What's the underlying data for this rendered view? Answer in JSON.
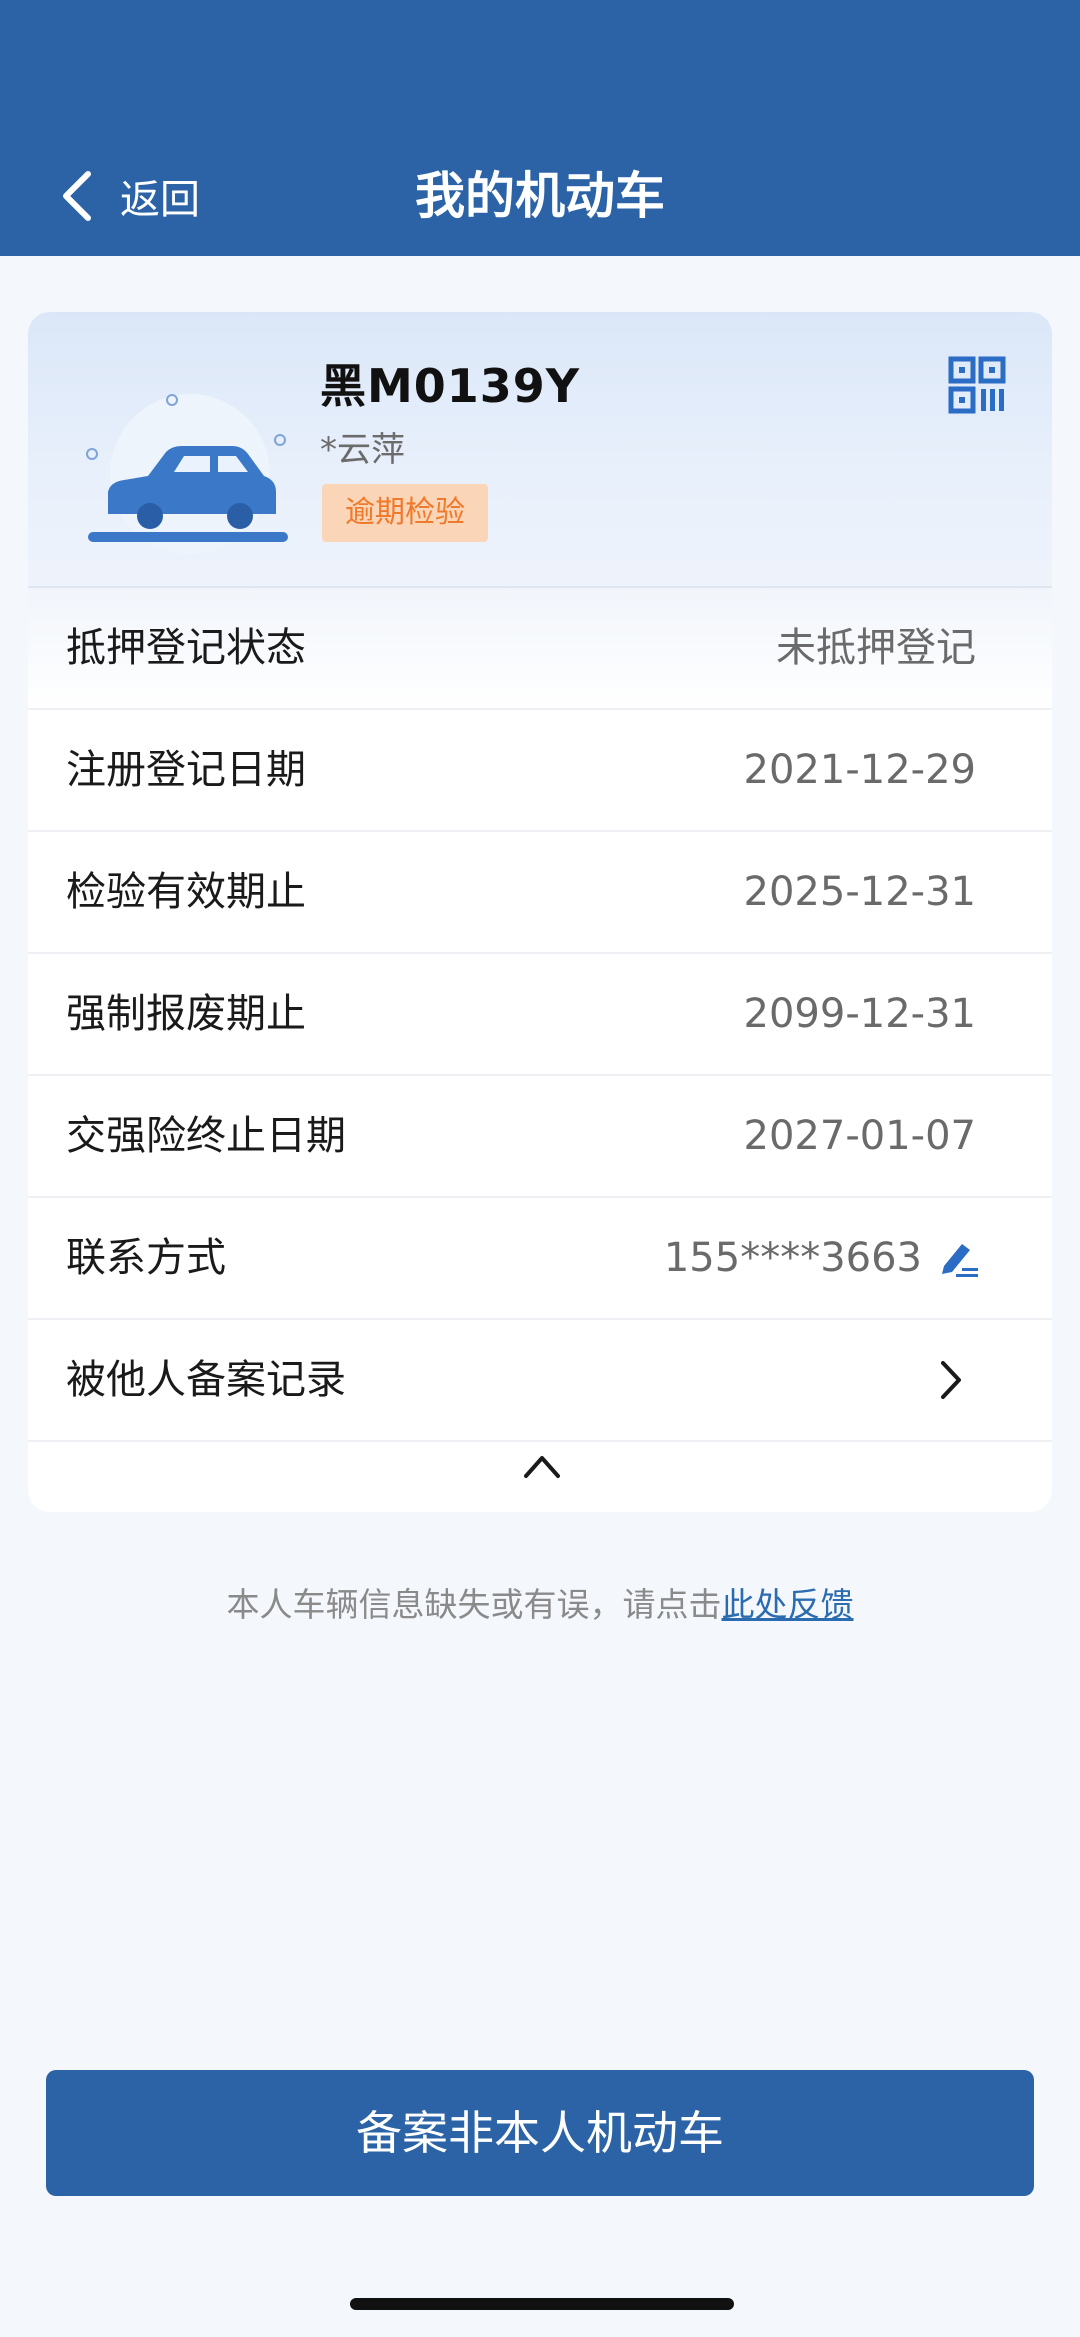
{
  "header": {
    "back_label": "返回",
    "title": "我的机动车",
    "background_color": "#2b63a6"
  },
  "vehicle": {
    "plate": "黑M0139Y",
    "owner": "*云萍",
    "status_badge": "逾期检验",
    "badge_color": "#f07a2c",
    "icons": [
      "car-icon",
      "qr-code-icon"
    ]
  },
  "details": [
    {
      "label": "抵押登记状态",
      "value": "未抵押登记"
    },
    {
      "label": "注册登记日期",
      "value": "2021-12-29"
    },
    {
      "label": "检验有效期止",
      "value": "2025-12-31"
    },
    {
      "label": "强制报废期止",
      "value": "2099-12-31"
    },
    {
      "label": "交强险终止日期",
      "value": "2027-01-07"
    },
    {
      "label": "联系方式",
      "value": "155****3663"
    },
    {
      "label": "被他人备案记录",
      "value": ""
    }
  ],
  "feedback": {
    "text": "本人车辆信息缺失或有误，请点击",
    "link": "此处反馈"
  },
  "primary_button": {
    "label": "备案非本人机动车"
  }
}
